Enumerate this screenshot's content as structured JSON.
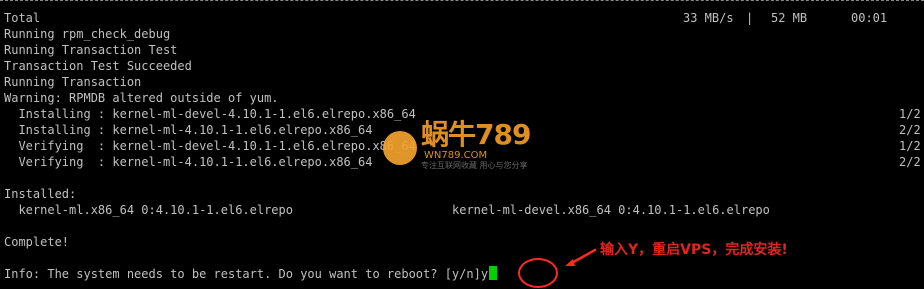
{
  "terminal": {
    "progress": {
      "label": "Total",
      "speed": "33 MB/s",
      "separator": "|",
      "size": "52 MB",
      "time": "00:01"
    },
    "lines": [
      "Running rpm_check_debug",
      "Running Transaction Test",
      "Transaction Test Succeeded",
      "Running Transaction",
      "Warning: RPMDB altered outside of yum."
    ],
    "steps": [
      {
        "text": "  Installing : kernel-ml-devel-4.10.1-1.el6.elrepo.x86_64",
        "count": "1/2"
      },
      {
        "text": "  Installing : kernel-ml-4.10.1-1.el6.elrepo.x86_64",
        "count": "2/2"
      },
      {
        "text": "  Verifying  : kernel-ml-devel-4.10.1-1.el6.elrepo.x86_64",
        "count": "1/2"
      },
      {
        "text": "  Verifying  : kernel-ml-4.10.1-1.el6.elrepo.x86_64",
        "count": "2/2"
      }
    ],
    "installed_header": "Installed:",
    "installed_left": "  kernel-ml.x86_64 0:4.10.1-1.el6.elrepo",
    "installed_right": "kernel-ml-devel.x86_64 0:4.10.1-1.el6.elrepo",
    "complete": "Complete!",
    "prompt": "Info: The system needs to be restart. Do you want to reboot? [y/n]",
    "input": "y"
  },
  "annotation": {
    "text": "输入Y，重启VPS，完成安装!",
    "color": "#e1251b"
  },
  "watermark": {
    "brand": "蜗牛789",
    "site": "WN789.COM",
    "slogan": "专注互联网收藏   用心与您分享"
  },
  "colors": {
    "background": "#000000",
    "text": "#c0c0c0",
    "cursor": "#00d100",
    "highlight": "#ff2a1f",
    "watermark": "#f29b23"
  }
}
